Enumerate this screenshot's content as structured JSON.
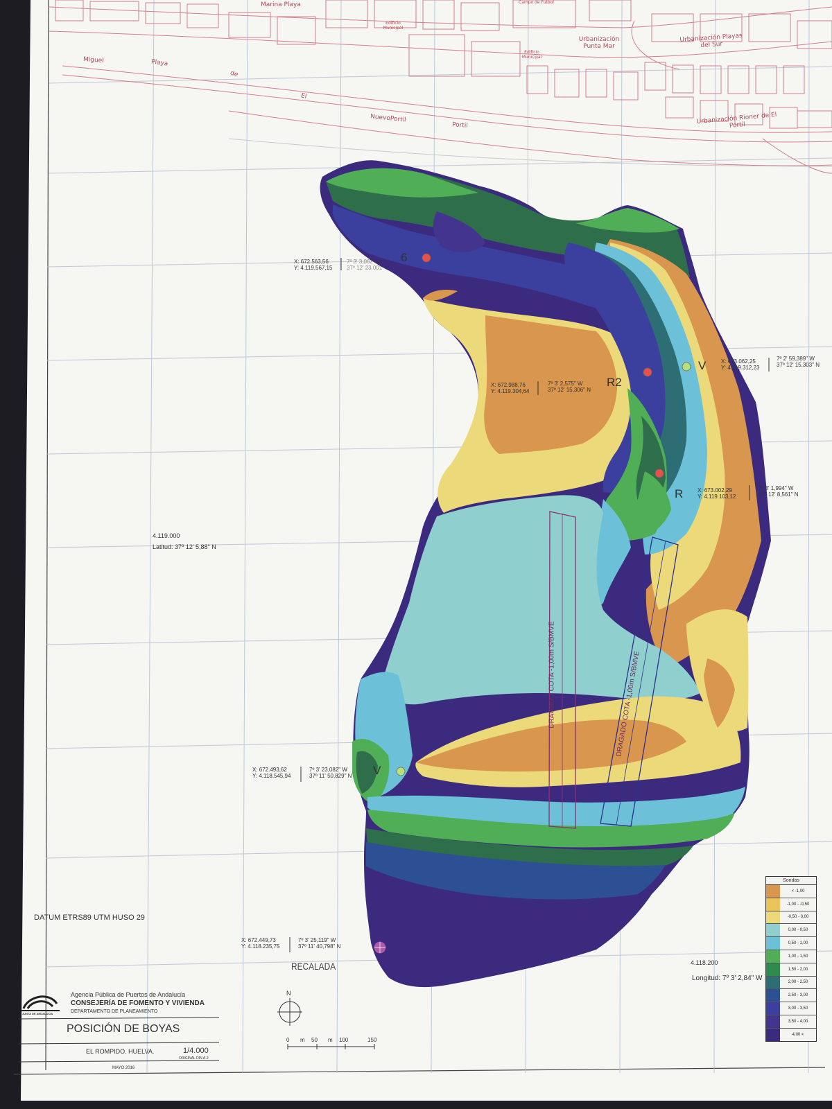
{
  "streets": {
    "marina_playa": "Marina Playa",
    "campo_de_futbol": "Campo de Futbol",
    "edificio_municipal_1": "Edificio Municipal",
    "edificio_municipal_2": "Edificio Municipal",
    "urb_punta_mar": "Urbanización Punta Mar",
    "urb_playas_del_sur": "Urbanización Playas del Sur",
    "urb_rioner": "Urbanización Rioner de El Portil",
    "miguel": "Miguel",
    "playa": "Playa",
    "de": "de",
    "el": "El",
    "nuevoportil": "NuevoPortil",
    "portil": "Portil"
  },
  "buoys": [
    {
      "tag": "6",
      "x_utm": "X:   672.563,56",
      "y_utm": "Y: 4.119.567,15",
      "lon": "7º 3' 3,062\" W",
      "lat": "37º 12' 23,001\" N",
      "color": "#e8504a"
    },
    {
      "tag": "R2",
      "x_utm": "X:   672.988,76",
      "y_utm": "Y: 4.119.304,64",
      "lon": "7º  3'  2,575\" W",
      "lat": "37º 12' 15,306\" N",
      "color": "#e8504a"
    },
    {
      "tag": "V",
      "x_utm": "X:   673.062,25",
      "y_utm": "Y: 4.119.312,23",
      "lon": "7º  2'  59,389\" W",
      "lat": "37º 12' 15,303\" N",
      "color": "#b8e07a"
    },
    {
      "tag": "R",
      "x_utm": "X:   673.002,29",
      "y_utm": "Y: 4.119.103,12",
      "lon": "7º  3'  1,994\" W",
      "lat": "37º 12'  8,561\" N",
      "color": "#e8504a"
    },
    {
      "tag": "V",
      "x_utm": "X:   672.493,62",
      "y_utm": "Y: 4.118.545,94",
      "lon": "7º 3' 23,082\" W",
      "lat": "37º 11' 50,829\" N",
      "color": "#b8e07a"
    },
    {
      "tag": "",
      "x_utm": "X:   672.449,73",
      "y_utm": "Y: 4.118.235,75",
      "lon": "7º 3' 25,119\" W",
      "lat": "37º 11' 40,798\" N",
      "color": "#e06ac0"
    }
  ],
  "recalada": "RECALADA",
  "grid": {
    "northing_label": "4.119.000",
    "latitude_label": "Latitud: 37º 12' 5,88\" N",
    "easting_label": "4.118.200",
    "longitude_label": "Longitud:  7º 3' 2,84\" W"
  },
  "dredge": {
    "label_1": "DRAGADO COTA  -1,00m S/BMVE",
    "label_2": "DRAGADO COTA  -1,00m S/BMVE"
  },
  "datum": "DATUM ETRS89 UTM HUSO 29",
  "title_block": {
    "agency": "Agencia Pública de Puertos de Andalucía",
    "ministry": "CONSEJERÍA DE FOMENTO Y VIVIENDA",
    "department": "DEPARTAMENTO DE PLANEAMIENTO",
    "logo_text": "JUNTA DE ANDALUCIA",
    "title": "POSICIÓN DE BOYAS",
    "location": "EL ROMPIDO. HUELVA.",
    "scale": "1/4.000",
    "original": "ORIGINAL DIN A-2",
    "date": "MAYO 2016"
  },
  "scale_bar": {
    "north": "N",
    "ticks": [
      "0",
      "m",
      "50",
      "m",
      "100",
      "150"
    ]
  },
  "legend": {
    "title": "Sondas",
    "items": [
      {
        "label": "< -1,00",
        "color": "#d9964e"
      },
      {
        "label": "-1,00 - -0,50",
        "color": "#e8c45a"
      },
      {
        "label": "-0,50 - 0,00",
        "color": "#ecd97a"
      },
      {
        "label": "0,00 - 0,50",
        "color": "#8fd0cf"
      },
      {
        "label": "0,50 - 1,00",
        "color": "#6cc0d8"
      },
      {
        "label": "1,00 - 1,50",
        "color": "#4fae56"
      },
      {
        "label": "1,50 - 2,00",
        "color": "#2f8a4e"
      },
      {
        "label": "2,00 - 2,50",
        "color": "#2c6e74"
      },
      {
        "label": "2,50 - 3,00",
        "color": "#2d4f93"
      },
      {
        "label": "3,00 - 3,50",
        "color": "#3b3f9e"
      },
      {
        "label": "3,50 - 4,00",
        "color": "#43358e"
      },
      {
        "label": "4,00 <",
        "color": "#3c2a7e"
      }
    ]
  }
}
